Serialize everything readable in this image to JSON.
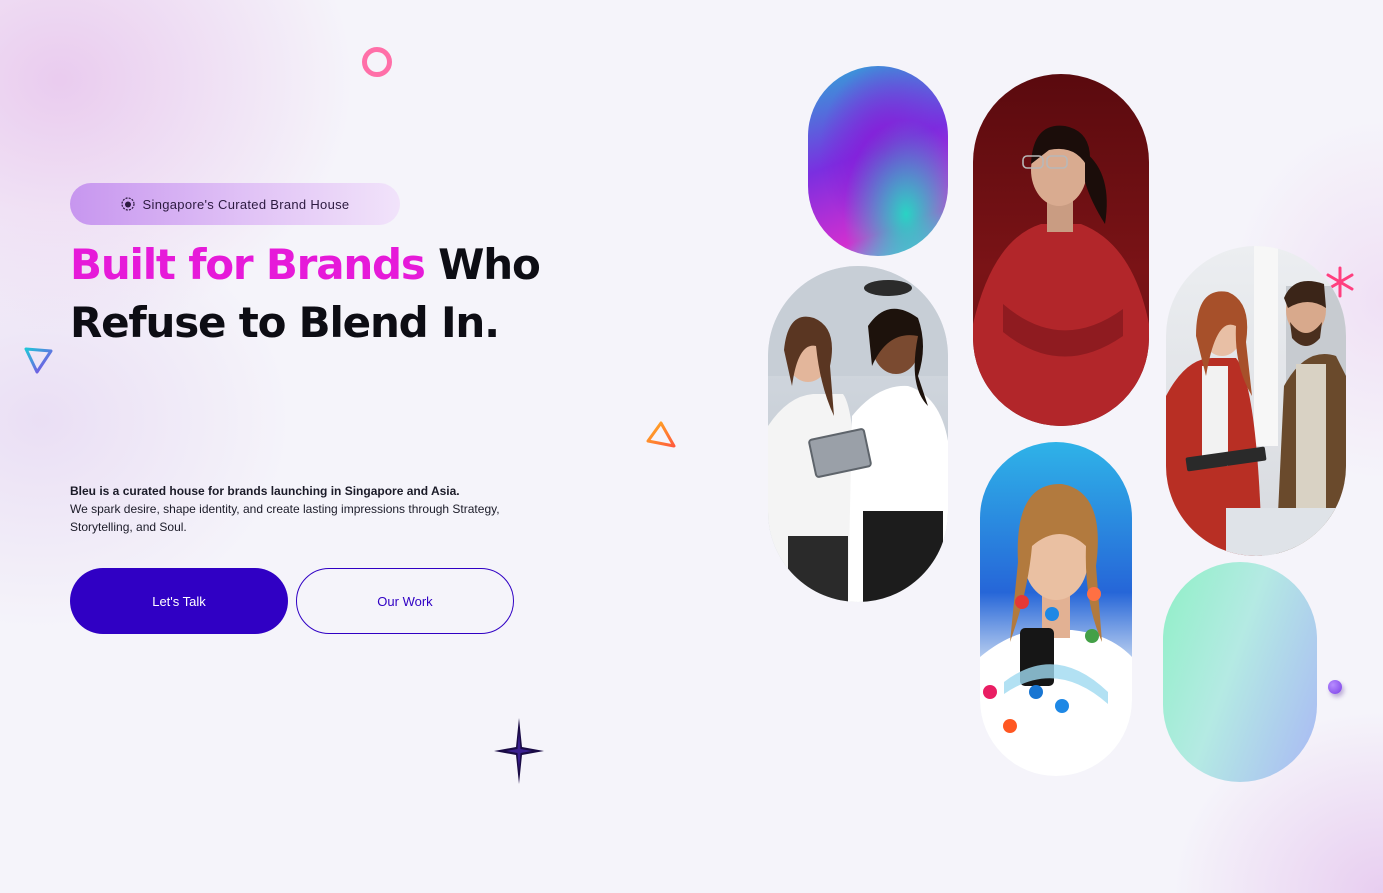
{
  "hero": {
    "badge_text": "Singapore's Curated Brand House",
    "headline_accent": "Built for Brands",
    "headline_rest": " Who Refuse to Blend In.",
    "description_lead": "Bleu is a curated house for brands launching in Singapore and Asia.",
    "description_body": "We spark desire, shape identity, and create lasting impressions through Strategy, Storytelling, and Soul.",
    "primary_button": "Let's Talk",
    "secondary_button": "Our Work"
  },
  "icons": {
    "badge": "lion-head-icon"
  },
  "colors": {
    "accent_pink": "#e61ad9",
    "primary_blue": "#3000c4",
    "headline": "#0d0d14",
    "badge_gradient_start": "#c796ef"
  }
}
